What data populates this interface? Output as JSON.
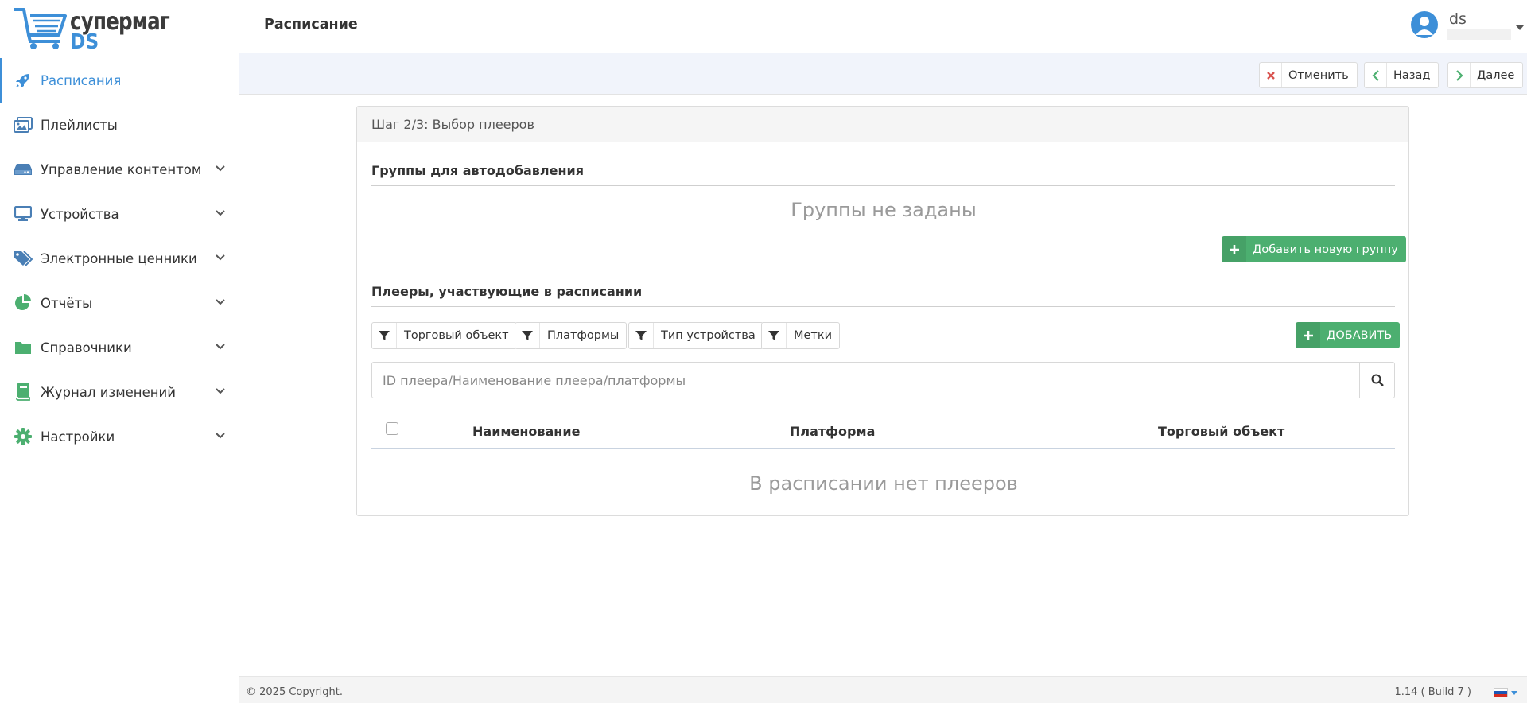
{
  "brand": {
    "line1": "супермаг",
    "line2": "DS"
  },
  "sidebar": {
    "items": [
      {
        "label": "Расписания",
        "icon": "rocket-icon",
        "active": true,
        "expandable": false
      },
      {
        "label": "Плейлисты",
        "icon": "images-icon",
        "active": false,
        "expandable": false
      },
      {
        "label": "Управление контентом",
        "icon": "drive-icon",
        "active": false,
        "expandable": true
      },
      {
        "label": "Устройства",
        "icon": "monitor-icon",
        "active": false,
        "expandable": true
      },
      {
        "label": "Электронные ценники",
        "icon": "tags-icon",
        "active": false,
        "expandable": true
      },
      {
        "label": "Отчёты",
        "icon": "pie-chart-icon",
        "active": false,
        "expandable": true
      },
      {
        "label": "Справочники",
        "icon": "folder-icon",
        "active": false,
        "expandable": true
      },
      {
        "label": "Журнал изменений",
        "icon": "book-icon",
        "active": false,
        "expandable": true
      },
      {
        "label": "Настройки",
        "icon": "gear-icon",
        "active": false,
        "expandable": true
      }
    ]
  },
  "header": {
    "title": "Расписание",
    "user": "ds"
  },
  "actions": {
    "cancel": "Отменить",
    "back": "Назад",
    "next": "Далее"
  },
  "wizard": {
    "step_title": "Шаг 2/3: Выбор плееров",
    "groups": {
      "title": "Группы для автодобавления",
      "empty": "Группы не заданы",
      "add_button": "Добавить новую группу"
    },
    "players": {
      "title": "Плееры, участвующие в расписании",
      "filters": [
        "Торговый объект",
        "Платформы",
        "Тип устройства",
        "Метки"
      ],
      "add_button": "ДОБАВИТЬ",
      "search_placeholder": "ID плеера/Наименование плеера/платформы",
      "columns": [
        "Наименование",
        "Платформа",
        "Торговый объект"
      ],
      "empty": "В расписании нет плееров"
    }
  },
  "footer": {
    "copyright": "© 2025 Copyright.",
    "version": "1.14 ( Build 7 )"
  },
  "colors": {
    "accent": "#3d8fd8",
    "success": "#4caf70",
    "danger": "#d9534f",
    "icon_green": "#4caf70"
  }
}
